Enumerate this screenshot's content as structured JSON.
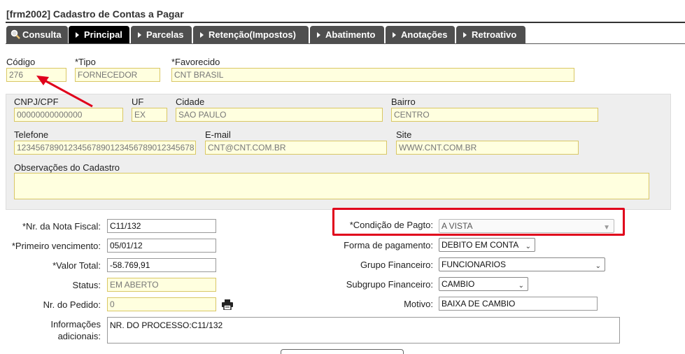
{
  "window": {
    "title": "[frm2002] Cadastro de Contas a Pagar"
  },
  "tabs": [
    {
      "label": "Consulta",
      "icon": "search-icon"
    },
    {
      "label": "Principal",
      "icon": "arrow-right-icon"
    },
    {
      "label": "Parcelas",
      "icon": "arrow-right-icon"
    },
    {
      "label": "Retenção(Impostos)",
      "icon": "arrow-right-icon"
    },
    {
      "label": "Abatimento",
      "icon": "arrow-right-icon"
    },
    {
      "label": "Anotações",
      "icon": "arrow-right-icon"
    },
    {
      "label": "Retroativo",
      "icon": "arrow-right-icon"
    }
  ],
  "header": {
    "codigo_label": "Código",
    "codigo_value": "276",
    "tipo_label": "*Tipo",
    "tipo_value": "FORNECEDOR",
    "favorecido_label": "*Favorecido",
    "favorecido_value": "CNT BRASIL"
  },
  "cadastro": {
    "cnpj_label": "CNPJ/CPF",
    "cnpj_value": "00000000000000",
    "uf_label": "UF",
    "uf_value": "EX",
    "cidade_label": "Cidade",
    "cidade_value": "SAO PAULO",
    "bairro_label": "Bairro",
    "bairro_value": "CENTRO",
    "telefone_label": "Telefone",
    "telefone_value": "12345678901234567890123456789012345678",
    "email_label": "E-mail",
    "email_value": "CNT@CNT.COM.BR",
    "site_label": "Site",
    "site_value": "WWW.CNT.COM.BR",
    "obs_label": "Observações do Cadastro",
    "obs_value": ""
  },
  "form_left": {
    "nota_label": "*Nr. da Nota Fiscal:",
    "nota_value": "C11/132",
    "venc_label": "*Primeiro vencimento:",
    "venc_value": "05/01/12",
    "valor_label": "*Valor Total:",
    "valor_value": "-58.769,91",
    "status_label": "Status:",
    "status_value": "EM ABERTO",
    "pedido_label": "Nr. do Pedido:",
    "pedido_value": "0",
    "info_label_1": "Informações",
    "info_label_2": "adicionais:",
    "info_value": "NR. DO PROCESSO:C11/132"
  },
  "form_right": {
    "condicao_label": "*Condição de Pagto:",
    "condicao_value": "A VISTA",
    "forma_label": "Forma de pagamento:",
    "forma_value": "DEBITO EM CONTA",
    "grupo_label": "Grupo Financeiro:",
    "grupo_value": "FUNCIONARIOS",
    "subgrupo_label": "Subgrupo Financeiro:",
    "subgrupo_value": "CAMBIO",
    "motivo_label": "Motivo:",
    "motivo_value": "BAIXA DE CAMBIO"
  },
  "colors": {
    "highlight_red": "#e0001b",
    "tab_bg": "#4f4f4f",
    "tab_active_bg": "#000000",
    "readonly_field_bg": "#ffffdf"
  }
}
